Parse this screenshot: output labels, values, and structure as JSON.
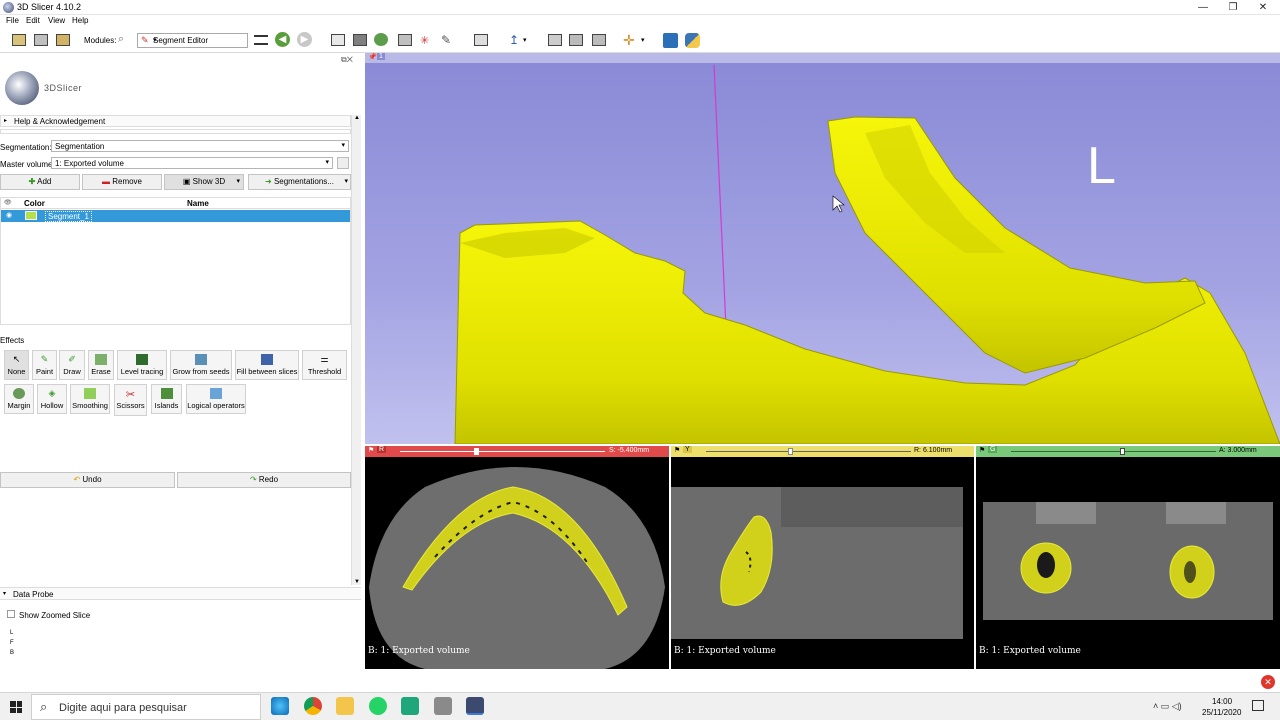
{
  "window": {
    "title": "3D Slicer 4.10.2",
    "controls": [
      "—",
      "❐",
      "✕"
    ]
  },
  "menu": [
    "File",
    "Edit",
    "View",
    "Help"
  ],
  "toolbar": {
    "modules_label": "Modules:",
    "module_selected": "Segment Editor"
  },
  "logo_text": "3DSlicer",
  "help_section": "Help & Acknowledgement",
  "segmentation": {
    "label": "Segmentation:",
    "value": "Segmentation"
  },
  "master_volume": {
    "label": "Master volume:",
    "value": "1: Exported volume"
  },
  "seg_buttons": {
    "add": "Add",
    "remove": "Remove",
    "show3d": "Show 3D",
    "segmentations": "Segmentations..."
  },
  "table": {
    "col_color": "Color",
    "col_name": "Name",
    "rows": [
      {
        "name": "Segment_1",
        "color": "#b4e04a"
      }
    ]
  },
  "effects": {
    "title": "Effects",
    "row1": [
      "None",
      "Paint",
      "Draw",
      "Erase",
      "Level tracing",
      "Grow from seeds",
      "Fill between slices",
      "Threshold"
    ],
    "row2": [
      "Margin",
      "Hollow",
      "Smoothing",
      "Scissors",
      "Islands",
      "Logical operators"
    ]
  },
  "undo": "Undo",
  "redo": "Redo",
  "data_probe": {
    "title": "Data Probe",
    "show_zoomed": "Show Zoomed Slice",
    "coords": [
      "L",
      "F",
      "B"
    ]
  },
  "view3d": {
    "tab": "1",
    "orientation_letter": "L"
  },
  "slices": [
    {
      "tag": "R",
      "offset": "S: -5.400mm",
      "caption": "B: 1: Exported volume",
      "color": "#e04a4a",
      "slider": 0.36
    },
    {
      "tag": "Y",
      "offset": "R: 6.100mm",
      "caption": "B: 1: Exported volume",
      "color": "#e8d85a",
      "slider": 0.4
    },
    {
      "tag": "G",
      "offset": "A: 3.000mm",
      "caption": "B: 1: Exported volume",
      "color": "#6fc06f",
      "slider": 0.53
    }
  ],
  "taskbar": {
    "search_placeholder": "Digite aqui para pesquisar",
    "time": "14:00",
    "date": "25/11/2020"
  },
  "colors": {
    "segment": "#e3e30f",
    "selection": "#3399d8",
    "bg3d": "#9999dd"
  }
}
